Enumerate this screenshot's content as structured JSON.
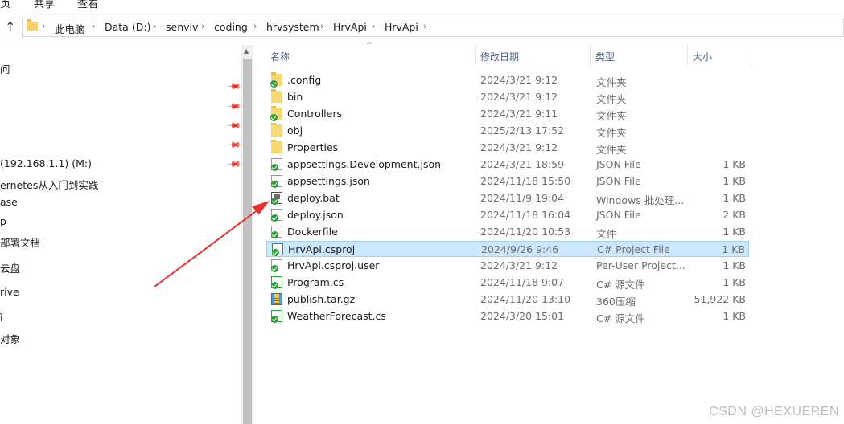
{
  "ribbon": {
    "tabs": [
      "页",
      "共享",
      "查看"
    ]
  },
  "address": {
    "up_icon": "up-arrow-icon",
    "crumbs": [
      "此电脑",
      "Data (D:)",
      "senviv",
      "coding",
      "hrvsystem",
      "HrvApi",
      "HrvApi"
    ]
  },
  "nav": {
    "items": [
      "问",
      "(192.168.1.1) (M:)",
      "ernetes从入门到实践",
      "ase",
      "p",
      "部署文档",
      "云盘",
      "rive",
      "ì",
      "对象"
    ]
  },
  "list": {
    "columns": {
      "name": "名称",
      "date": "修改日期",
      "type": "类型",
      "size": "大小"
    },
    "rows": [
      {
        "name": ".config",
        "date": "2024/3/21 9:12",
        "type": "文件夹",
        "size": "",
        "icon": "folder-icon"
      },
      {
        "name": "bin",
        "date": "2024/3/21 9:12",
        "type": "文件夹",
        "size": "",
        "icon": "folder-icon"
      },
      {
        "name": "Controllers",
        "date": "2024/3/21 9:11",
        "type": "文件夹",
        "size": "",
        "icon": "folder-icon"
      },
      {
        "name": "obj",
        "date": "2025/2/13 17:52",
        "type": "文件夹",
        "size": "",
        "icon": "folder-icon"
      },
      {
        "name": "Properties",
        "date": "2024/3/21 9:12",
        "type": "文件夹",
        "size": "",
        "icon": "folder-icon"
      },
      {
        "name": "appsettings.Development.json",
        "date": "2024/3/21 18:59",
        "type": "JSON File",
        "size": "1 KB",
        "icon": "json-file-icon"
      },
      {
        "name": "appsettings.json",
        "date": "2024/11/18 15:50",
        "type": "JSON File",
        "size": "1 KB",
        "icon": "json-file-icon"
      },
      {
        "name": "deploy.bat",
        "date": "2024/11/9 19:04",
        "type": "Windows 批处理...",
        "size": "1 KB",
        "icon": "batch-file-icon"
      },
      {
        "name": "deploy.json",
        "date": "2024/11/18 16:04",
        "type": "JSON File",
        "size": "2 KB",
        "icon": "json-file-icon"
      },
      {
        "name": "Dockerfile",
        "date": "2024/11/20 10:53",
        "type": "文件",
        "size": "1 KB",
        "icon": "file-icon"
      },
      {
        "name": "HrvApi.csproj",
        "date": "2024/9/26 9:46",
        "type": "C# Project File",
        "size": "1 KB",
        "icon": "csproj-file-icon"
      },
      {
        "name": "HrvApi.csproj.user",
        "date": "2024/3/21 9:12",
        "type": "Per-User Project...",
        "size": "1 KB",
        "icon": "file-icon"
      },
      {
        "name": "Program.cs",
        "date": "2024/11/18 9:07",
        "type": "C# 源文件",
        "size": "1 KB",
        "icon": "cs-file-icon"
      },
      {
        "name": "publish.tar.gz",
        "date": "2024/11/20 13:10",
        "type": "360压缩",
        "size": "51,922 KB",
        "icon": "archive-icon"
      },
      {
        "name": "WeatherForecast.cs",
        "date": "2024/3/20 15:01",
        "type": "C# 源文件",
        "size": "1 KB",
        "icon": "cs-file-icon"
      }
    ],
    "selected_index": 10
  },
  "colors": {
    "selection_bg": "#cce8ff",
    "selection_border": "#99d1ff",
    "arrow": "#e8312f"
  },
  "watermark": "CSDN @HEXUEREN"
}
